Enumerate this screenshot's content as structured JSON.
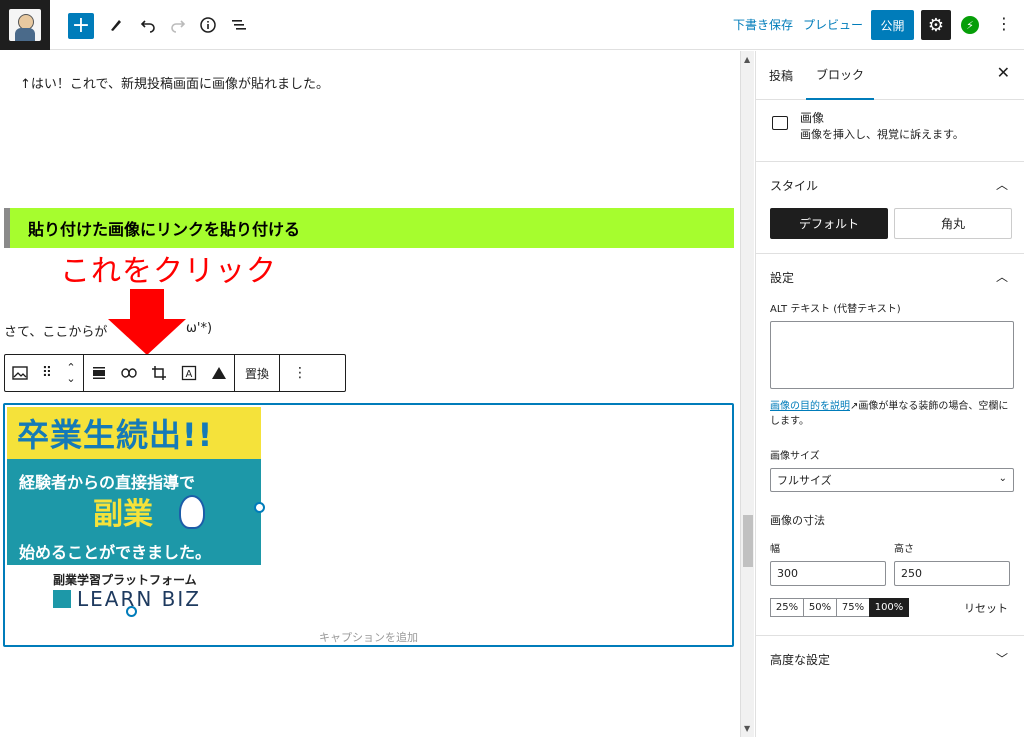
{
  "topbar": {
    "draft_save": "下書き保存",
    "preview": "プレビュー",
    "publish": "公開"
  },
  "editor": {
    "para1": "↑はい！これで、新規投稿画面に画像が貼れました。",
    "heading": "貼り付けた画像にリンクを貼り付ける",
    "annotation": "これをクリック",
    "annotation_color": "#ff0000",
    "para2_head": "さて、ここからが",
    "para2_tail": "ω'*)",
    "toolbar": {
      "replace": "置換"
    },
    "banner": {
      "top": "卒業生続出!!",
      "line1": "経験者からの直接指導で",
      "line2": "副業",
      "line3": "始めることができました。",
      "brand_sub": "副業学習プラットフォーム",
      "brand": "LEARN BIZ"
    },
    "caption_placeholder": "キャプションを追加",
    "heading_bg": "#a6fd2e"
  },
  "sidebar": {
    "tabs": [
      "投稿",
      "ブロック"
    ],
    "block_title": "画像",
    "block_desc": "画像を挿入し、視覚に訴えます。",
    "style_title": "スタイル",
    "style_options": [
      "デフォルト",
      "角丸"
    ],
    "settings_title": "設定",
    "alt_label": "ALT テキスト (代替テキスト)",
    "alt_help_link": "画像の目的を説明",
    "alt_help_text": "画像が単なる装飾の場合、空欄にします。",
    "image_size_label": "画像サイズ",
    "image_size_value": "フルサイズ",
    "dimensions_label": "画像の寸法",
    "width_label": "幅",
    "height_label": "高さ",
    "width_value": "300",
    "height_value": "250",
    "percent_options": [
      "25%",
      "50%",
      "75%",
      "100%"
    ],
    "reset": "リセット",
    "advanced": "高度な設定"
  },
  "accent_color": "#007cba"
}
